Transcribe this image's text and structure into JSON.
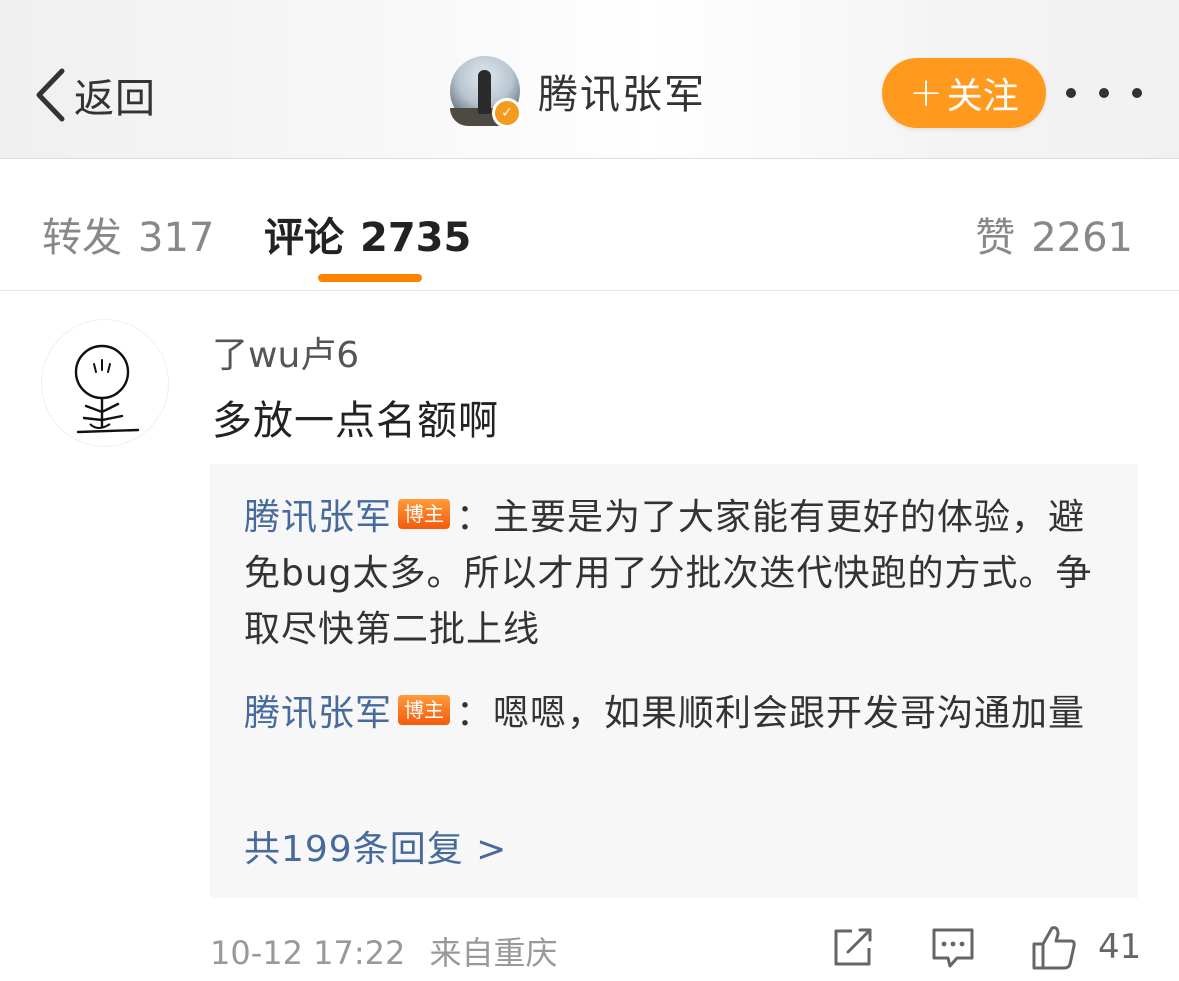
{
  "header": {
    "back_label": "返回",
    "author_name": "腾讯张军",
    "follow_label": "关注",
    "follow_plus": "+"
  },
  "tabs": {
    "repost_label": "转发",
    "repost_count": "317",
    "comment_label": "评论",
    "comment_count": "2735",
    "like_label": "赞",
    "like_count": "2261",
    "active": "评论"
  },
  "comment": {
    "username": "了wu卢6",
    "text": "多放一点名额啊",
    "replies": [
      {
        "author": "腾讯张军",
        "badge": "博主",
        "separator": "：",
        "text": "主要是为了大家能有更好的体验，避免bug太多。所以才用了分批次迭代快跑的方式。争取尽快第二批上线"
      },
      {
        "author": "腾讯张军",
        "badge": "博主",
        "separator": "：",
        "text": "嗯嗯，如果顺利会跟开发哥沟通加量"
      }
    ],
    "more_replies": "共199条回复 >",
    "time": "10-12 17:22",
    "source": "来自重庆",
    "like_count": "41"
  },
  "colors": {
    "accent_orange": "#ff8200",
    "follow_button": "#ff9a1e",
    "link_blue": "#476a9c",
    "badge_orange": "#f45a0c"
  },
  "icons": {
    "back": "chevron-left-icon",
    "more": "more-dots-icon",
    "share": "share-edit-icon",
    "reply": "comment-bubble-icon",
    "like": "thumbs-up-icon",
    "verified": "verified-badge-icon"
  }
}
